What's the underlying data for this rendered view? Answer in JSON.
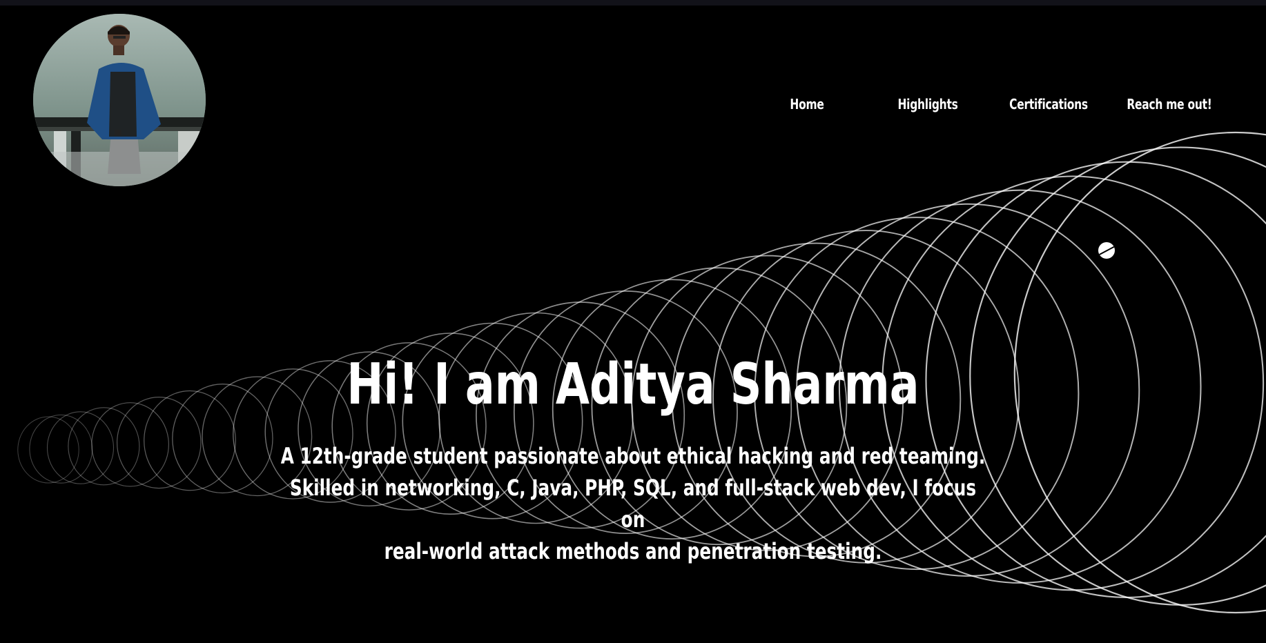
{
  "avatar": {
    "alt": "Aditya Sharma profile photo"
  },
  "nav": {
    "items": [
      {
        "label": "Home"
      },
      {
        "label": "Highlights"
      },
      {
        "label": "Certifications"
      },
      {
        "label": "Reach me out!"
      }
    ]
  },
  "hero": {
    "title": "Hi! I am Aditya Sharma",
    "description_lines": [
      "A 12th-grade student passionate about ethical hacking and red teaming.",
      "Skilled in networking, C, Java, PHP, SQL, and full-stack web dev, I focus on",
      "real-world attack methods and penetration testing."
    ]
  },
  "colors": {
    "background": "#000000",
    "text": "#ffffff",
    "rings": "#ffffff",
    "top_strip": "#121219"
  },
  "icons": {
    "cursor": "cursor-dot-icon"
  }
}
